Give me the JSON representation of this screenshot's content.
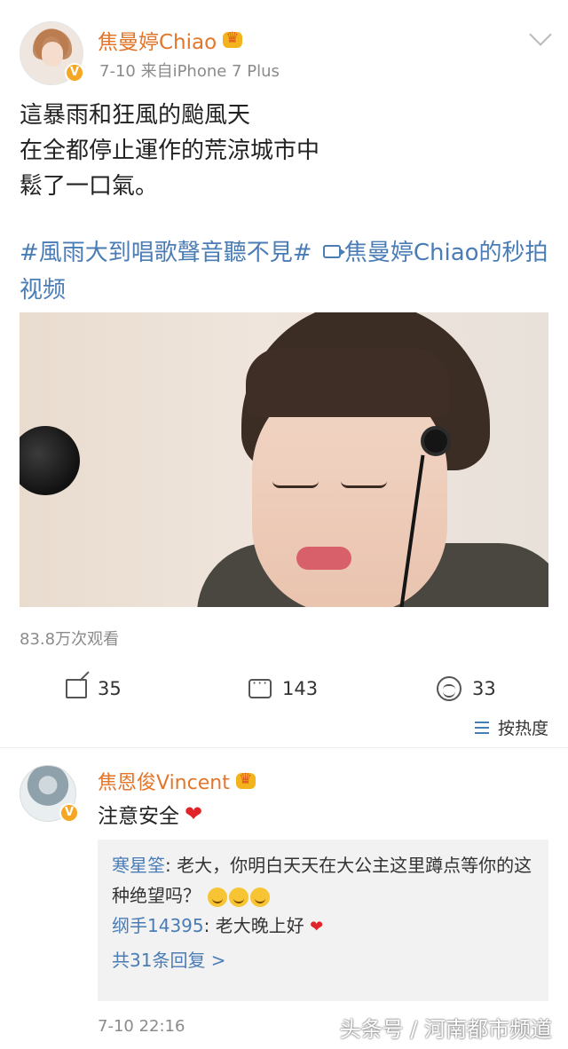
{
  "post": {
    "username": "焦曼婷Chiao",
    "meta": "7-10  来自iPhone 7 Plus",
    "text_lines": [
      "這暴雨和狂風的颱風天",
      "在全都停止運作的荒涼城市中",
      "鬆了一口氣。"
    ],
    "topic": "#風雨大到唱歌聲音聽不見#",
    "video_link": "焦曼婷Chiao的秒拍视频",
    "view_count": "83.8万次观看"
  },
  "actions": {
    "repost_count": "35",
    "comment_count": "143",
    "like_count": "33",
    "sort_label": "按热度"
  },
  "comment": {
    "username": "焦恩俊Vincent",
    "text": "注意安全",
    "replies": [
      {
        "user": "寒星筌",
        "text": "老大，你明白天天在大公主这里蹲点等你的这种绝望吗？"
      },
      {
        "user": "纲手14395",
        "text": "老大晚上好"
      }
    ],
    "reply_count_link": "共31条回复 >",
    "time": "7-10 22:16"
  },
  "watermark": "头条号 / 河南都市频道",
  "icons": {
    "verify": "verify-badge-icon",
    "crown": "crown-icon",
    "repost": "repost-icon",
    "comment": "comment-icon",
    "like": "like-icon",
    "heart": "heart-icon",
    "emoji": "laughing-emoji-icon"
  },
  "colors": {
    "username": "#e2762b",
    "link": "#4a7cb5",
    "meta": "#8b8b8b",
    "heart": "#e0242a"
  }
}
